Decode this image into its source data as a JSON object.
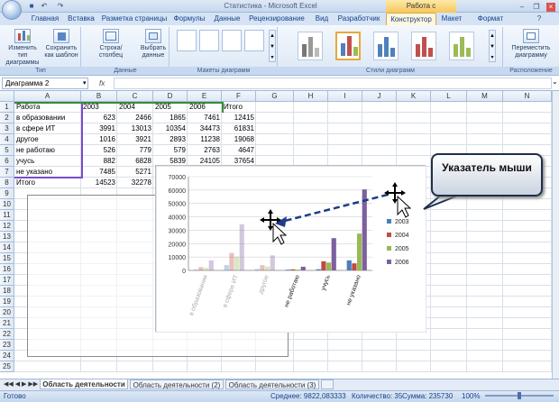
{
  "window": {
    "title": "Статистика - Microsoft Excel",
    "context_title": "Работа с диаграммами"
  },
  "tabs": [
    "Главная",
    "Вставка",
    "Разметка страницы",
    "Формулы",
    "Данные",
    "Рецензирование",
    "Вид",
    "Разработчик",
    "Конструктор",
    "Макет",
    "Формат"
  ],
  "active_tab": "Конструктор",
  "ribbon": {
    "groups": {
      "type": "Тип",
      "data": "Данные",
      "layouts": "Макеты диаграмм",
      "styles": "Стили диаграмм",
      "location": "Расположение"
    },
    "buttons": {
      "change_type": "Изменить тип диаграммы",
      "save_template": "Сохранить как шаблон",
      "row_col": "Строка/столбец",
      "select_data": "Выбрать данные",
      "move_chart": "Переместить диаграмму"
    }
  },
  "name_box": "Диаграмма 2",
  "fx": "fx",
  "columns": [
    "A",
    "B",
    "C",
    "D",
    "E",
    "F",
    "G",
    "H",
    "I",
    "J",
    "K",
    "L",
    "M",
    "N"
  ],
  "rows": [
    "1",
    "2",
    "3",
    "4",
    "5",
    "6",
    "7",
    "8",
    "9",
    "10",
    "11",
    "12",
    "13",
    "14",
    "15",
    "16",
    "17",
    "18",
    "19",
    "20",
    "21",
    "22",
    "23",
    "24",
    "25"
  ],
  "table": {
    "header": [
      "Работа",
      "2003",
      "2004",
      "2005",
      "2006",
      "Итого"
    ],
    "body": [
      [
        "в образовании",
        "623",
        "2466",
        "1865",
        "7461",
        "12415"
      ],
      [
        "в сфере ИТ",
        "3991",
        "13013",
        "10354",
        "34473",
        "61831"
      ],
      [
        "другое",
        "1016",
        "3921",
        "2893",
        "11238",
        "19068"
      ],
      [
        "не работаю",
        "526",
        "779",
        "579",
        "2763",
        "4647"
      ],
      [
        "учусь",
        "882",
        "6828",
        "5839",
        "24105",
        "37654"
      ],
      [
        "не указано",
        "7485",
        "5271",
        "",
        "",
        ""
      ],
      [
        "Итого",
        "14523",
        "32278",
        "",
        "",
        ""
      ]
    ]
  },
  "chart_data": {
    "type": "bar",
    "categories": [
      "в образовании",
      "в сфере ИТ",
      "другое",
      "не работаю",
      "учусь",
      "не указано"
    ],
    "series": [
      {
        "name": "2003",
        "values": [
          623,
          3991,
          1016,
          526,
          882,
          7485
        ],
        "color": "#4a7ebb"
      },
      {
        "name": "2004",
        "values": [
          2466,
          13013,
          3921,
          779,
          6828,
          5271
        ],
        "color": "#be4b48"
      },
      {
        "name": "2005",
        "values": [
          1865,
          10354,
          2893,
          579,
          5839,
          27500
        ],
        "color": "#98b954"
      },
      {
        "name": "2006",
        "values": [
          7461,
          34473,
          11238,
          2763,
          24105,
          60500
        ],
        "color": "#7d60a0"
      }
    ],
    "y_ticks": [
      "70000",
      "60000",
      "50000",
      "40000",
      "30000",
      "20000",
      "10000",
      "0"
    ],
    "ylim": [
      0,
      70000
    ],
    "faded_categories": 3,
    "legend": "right"
  },
  "callout": "Указатель мыши",
  "sheet_tabs": [
    "Область деятельности",
    "Область деятельности (2)",
    "Область деятельности (3)"
  ],
  "status": {
    "ready": "Готово",
    "average": "Среднее: 9822,083333",
    "count": "Количество: 35",
    "sum": "Сумма: 235730",
    "zoom": "100%"
  }
}
